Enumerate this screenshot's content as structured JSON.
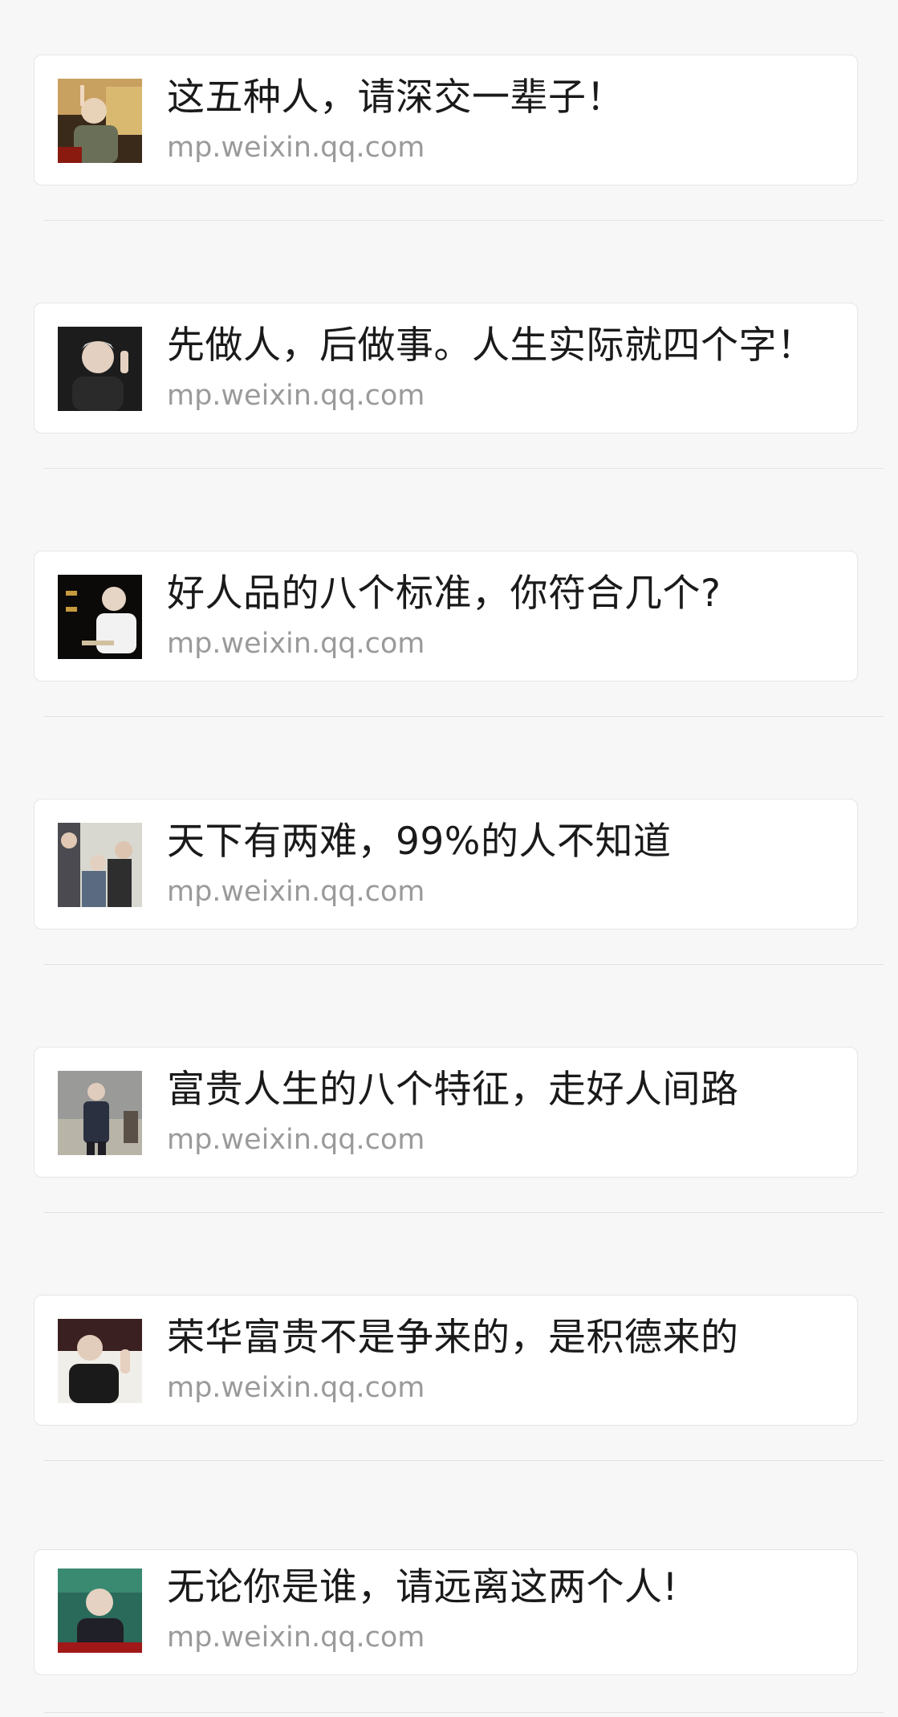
{
  "links": [
    {
      "title": "这五种人，请深交一辈子！",
      "domain": "mp.weixin.qq.com",
      "thumbnail": "elderly-man-pointing-photo"
    },
    {
      "title": "先做人，后做事。人生实际就四个字！",
      "domain": "mp.weixin.qq.com",
      "thumbnail": "elderly-man-speaking-photo"
    },
    {
      "title": "好人品的八个标准，你符合几个?",
      "domain": "mp.weixin.qq.com",
      "thumbnail": "elderly-man-calligraphy-photo"
    },
    {
      "title": "天下有两难，99%的人不知道",
      "domain": "mp.weixin.qq.com",
      "thumbnail": "group-of-people-photo"
    },
    {
      "title": "富贵人生的八个特征，走好人间路",
      "domain": "mp.weixin.qq.com",
      "thumbnail": "man-walking-photo"
    },
    {
      "title": "荣华富贵不是争来的，是积德来的",
      "domain": "mp.weixin.qq.com",
      "thumbnail": "elderly-man-gesturing-photo"
    },
    {
      "title": "无论你是谁，请远离这两个人!",
      "domain": "mp.weixin.qq.com",
      "thumbnail": "elderly-man-lecture-photo"
    }
  ]
}
